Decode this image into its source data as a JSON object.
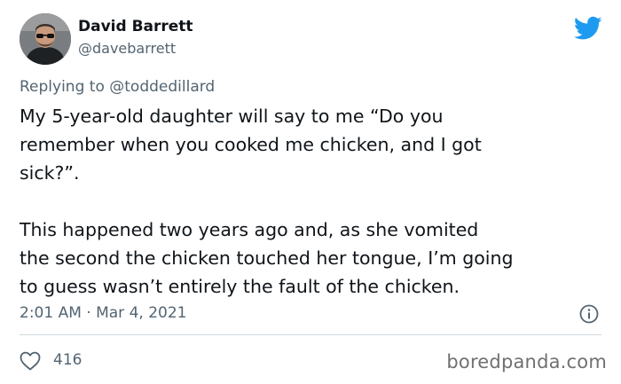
{
  "author": {
    "display_name": "David Barrett",
    "handle": "@davebarrett",
    "avatar_icon": "profile-photo"
  },
  "brand": {
    "logo_icon": "twitter-bird-icon",
    "color": "#1d9bf0"
  },
  "reply": {
    "prefix": "Replying to",
    "mention": "@toddedillard"
  },
  "tweet": {
    "paragraphs": [
      "My 5-year-old daughter will say to me “Do you\nremember when you cooked me chicken, and I got\nsick?”.",
      "This happened two years ago and, as she vomited\nthe second the chicken touched her tongue, I’m going\nto guess wasn’t entirely the fault of the chicken."
    ]
  },
  "meta": {
    "timestamp": "2:01 AM · Mar 4, 2021",
    "info_icon": "info-icon"
  },
  "engagement": {
    "like_icon": "heart-icon",
    "like_count": "416"
  },
  "watermark": "boredpanda.com",
  "colors": {
    "text": "#0f1419",
    "secondary": "#536471",
    "divider": "#cfd9de",
    "watermark": "#707070"
  }
}
